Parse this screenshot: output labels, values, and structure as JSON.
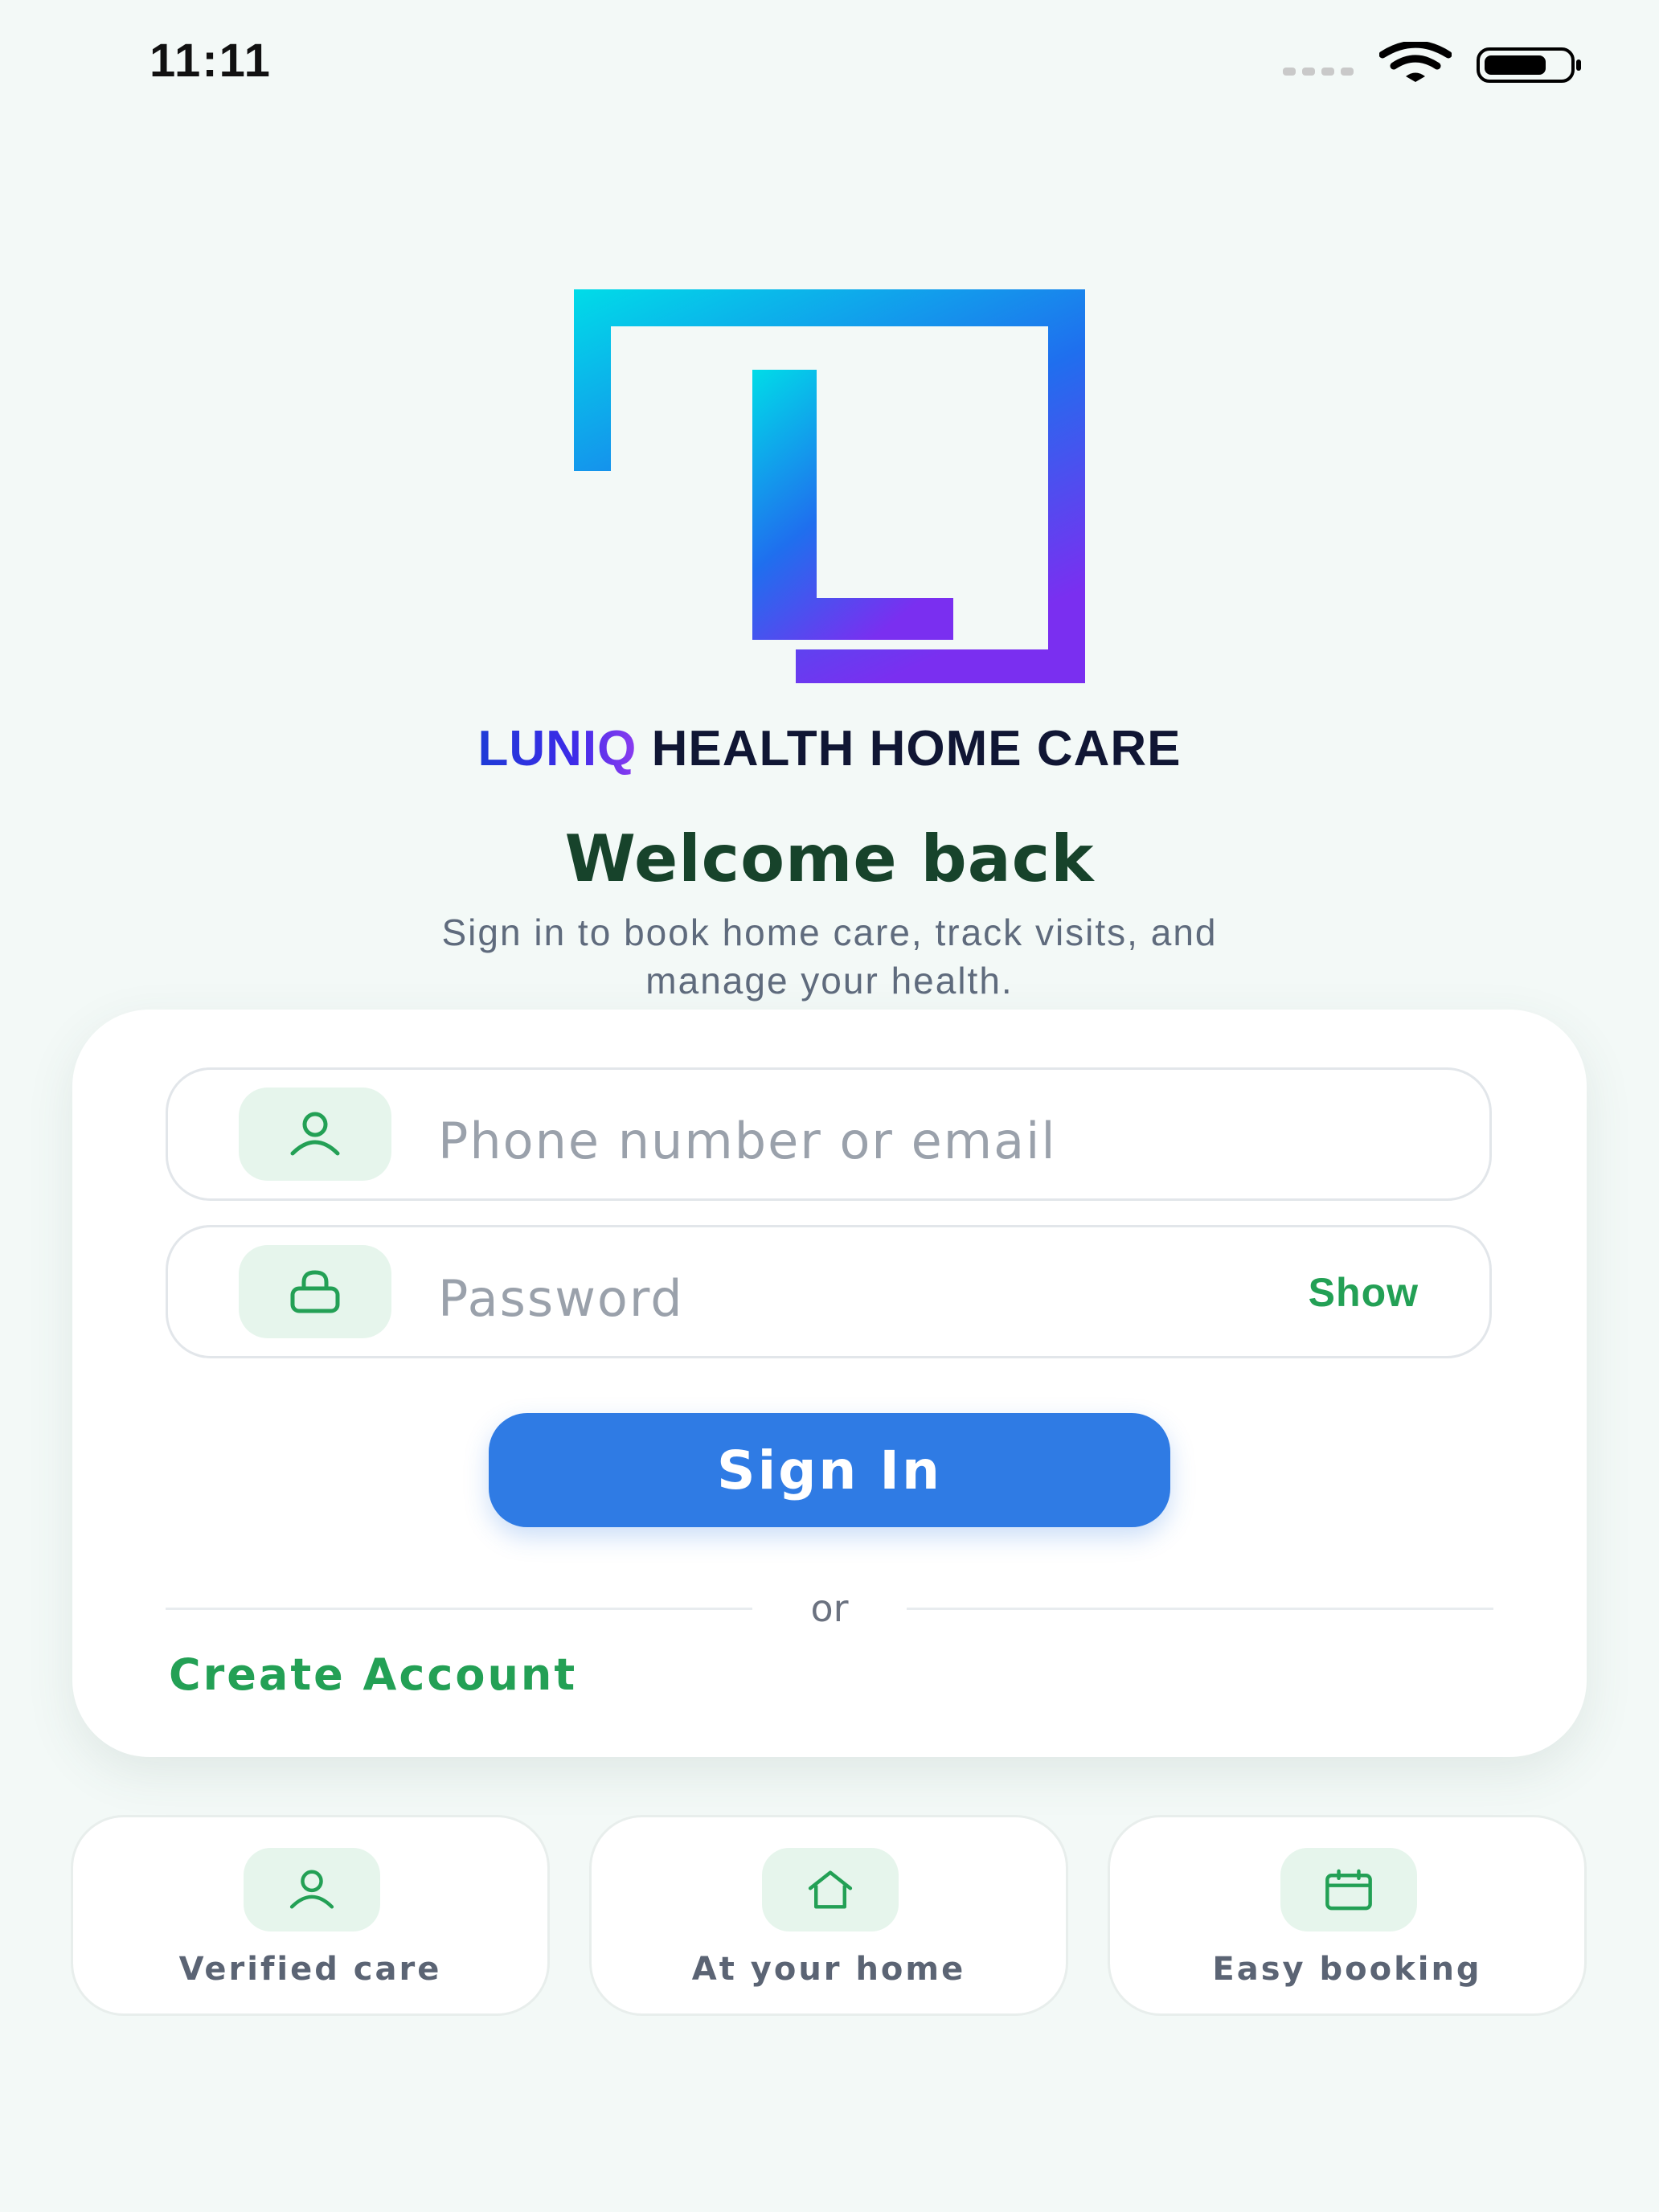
{
  "status_bar": {
    "time": "11:11"
  },
  "brand": {
    "name_part1": "LUNIQ",
    "name_part2": "HEALTH HOME CARE"
  },
  "header": {
    "title": "Welcome back",
    "subtitle_line1": "Sign in to book home care, track visits, and",
    "subtitle_line2": "manage your health."
  },
  "form": {
    "identifier_placeholder": "Phone number or email",
    "password_placeholder": "Password",
    "show_label": "Show",
    "signin_label": "Sign In",
    "divider_label": "or",
    "create_account_label": "Create Account"
  },
  "features": [
    {
      "label": "Verified care",
      "icon": "person-icon"
    },
    {
      "label": "At your home",
      "icon": "home-icon"
    },
    {
      "label": "Easy booking",
      "icon": "calendar-icon"
    }
  ],
  "colors": {
    "background": "#f3f9f7",
    "primary": "#2f7be4",
    "accent_green": "#23a055",
    "title_green": "#17432b",
    "icon_bg": "#e6f5ec"
  }
}
